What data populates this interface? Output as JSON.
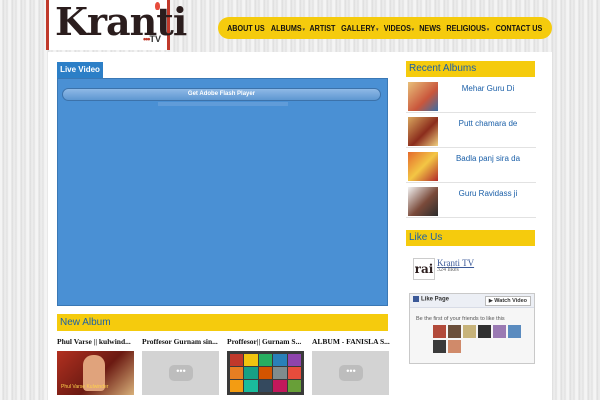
{
  "logo": {
    "brand": "Kranti",
    "suffix": "TV",
    "dots": "•••"
  },
  "nav": {
    "items": [
      {
        "label": "ABOUT US",
        "dropdown": false
      },
      {
        "label": "ALBUMS",
        "dropdown": true
      },
      {
        "label": "ARTIST",
        "dropdown": false
      },
      {
        "label": "GALLERY",
        "dropdown": true
      },
      {
        "label": "VIDEOS",
        "dropdown": true
      },
      {
        "label": "NEWS",
        "dropdown": false
      },
      {
        "label": "RELIGIOUS",
        "dropdown": true
      },
      {
        "label": "CONTACT US",
        "dropdown": false
      }
    ],
    "dropdown_icon": "▾"
  },
  "live": {
    "tab_label": "Live Video",
    "flash_button": "Get Adobe Flash Player"
  },
  "new_album": {
    "heading": "New Album",
    "items": [
      {
        "title": "Phul Varse || kulwind...",
        "thumb": "red",
        "caption": "Phul Varse Kulwinder"
      },
      {
        "title": "Proffesor Gurnam sin...",
        "thumb": "gray"
      },
      {
        "title": "Proffesor|| Gurnam S...",
        "thumb": "mosaic"
      },
      {
        "title": "ALBUM - FANISLA S...",
        "thumb": "gray"
      }
    ],
    "play_icon": "•••"
  },
  "recent_albums": {
    "heading": "Recent Albums",
    "items": [
      {
        "title": "Mehar Guru Di"
      },
      {
        "title": "Putt chamara de"
      },
      {
        "title": "Badla panj sira da"
      },
      {
        "title": "Guru Ravidass ji"
      }
    ]
  },
  "like_us": {
    "heading": "Like Us",
    "logo_text": "rai",
    "page_name": "Kranti TV",
    "likes": "324 likes",
    "like_page_button": "Like Page",
    "watch_video_button": "Watch Video",
    "first_friends": "Be the first of your friends to like this"
  },
  "colors": {
    "accent": "#f5cb0d",
    "link": "#1a5fa8",
    "player": "#4a90d4",
    "tab": "#2c7fc7"
  }
}
